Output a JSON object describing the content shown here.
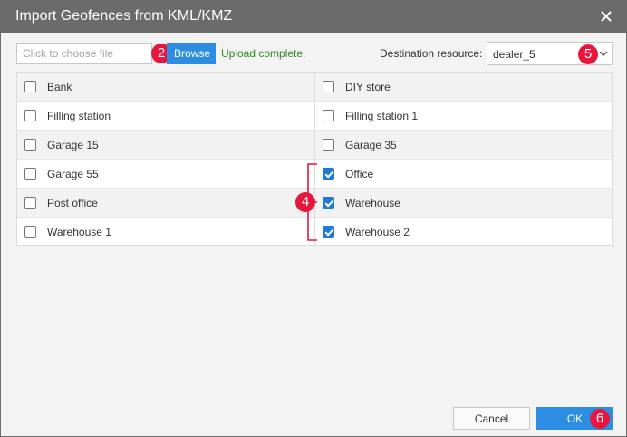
{
  "dialog": {
    "title": "Import Geofences from KML/KMZ"
  },
  "file": {
    "placeholder": "Click to choose file",
    "browse_label": "Browse",
    "status": "Upload complete."
  },
  "destination": {
    "label": "Destination resource:",
    "value": "dealer_5"
  },
  "geofences": {
    "rows": [
      {
        "left": {
          "label": "Bank",
          "checked": false
        },
        "right": {
          "label": "DIY store",
          "checked": false
        }
      },
      {
        "left": {
          "label": "Filling station",
          "checked": false
        },
        "right": {
          "label": "Filling station 1",
          "checked": false
        }
      },
      {
        "left": {
          "label": "Garage 15",
          "checked": false
        },
        "right": {
          "label": "Garage 35",
          "checked": false
        }
      },
      {
        "left": {
          "label": "Garage 55",
          "checked": false
        },
        "right": {
          "label": "Office",
          "checked": true
        }
      },
      {
        "left": {
          "label": "Post office",
          "checked": false
        },
        "right": {
          "label": "Warehouse",
          "checked": true
        }
      },
      {
        "left": {
          "label": "Warehouse 1",
          "checked": false
        },
        "right": {
          "label": "Warehouse 2",
          "checked": true
        }
      }
    ]
  },
  "callouts": {
    "browse": "2",
    "selection": "4",
    "destination": "5",
    "ok": "6",
    "color": "#e8163c"
  },
  "footer": {
    "cancel_label": "Cancel",
    "ok_label": "OK"
  },
  "colors": {
    "titlebar": "#6b6b6b",
    "accent": "#2d8de3",
    "success": "#2e8b20"
  }
}
